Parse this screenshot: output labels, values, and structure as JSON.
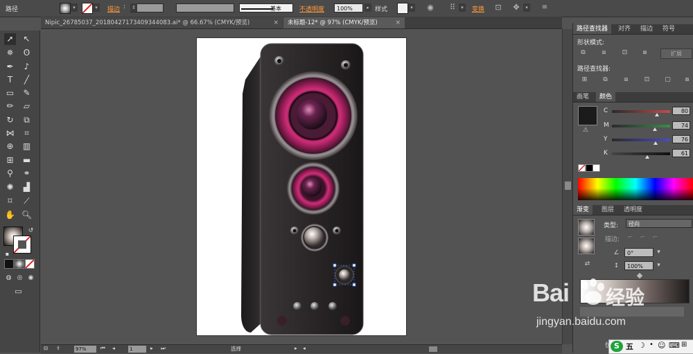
{
  "control_bar": {
    "path_label": "路径",
    "stroke_label": "描边",
    "stroke_style": "基本",
    "opacity_label": "不透明度",
    "opacity_value": "100%",
    "style_label": "样式",
    "transform_label": "变换"
  },
  "tabs": [
    {
      "label": "Nipic_26785037_20180427173409344083.ai* @ 66.67% (CMYK/预览)"
    },
    {
      "label": "未标题-12* @ 97% (CMYK/预览)"
    }
  ],
  "status": {
    "zoom": "97%",
    "page": "1",
    "mode": "选择"
  },
  "pathfinder": {
    "tabs": [
      "路径查找器",
      "对齐",
      "描边",
      "符号"
    ],
    "shape_modes_label": "形状模式:",
    "expand_label": "扩展",
    "pathfinders_label": "路径查找器:"
  },
  "color_panel": {
    "tabs": [
      "画笔",
      "颜色"
    ],
    "channels": [
      {
        "letter": "C",
        "value": "80",
        "color": "#c44b4b"
      },
      {
        "letter": "M",
        "value": "74",
        "color": "#3c8c4c"
      },
      {
        "letter": "Y",
        "value": "76",
        "color": "#4b4bc4"
      },
      {
        "letter": "K",
        "value": "61",
        "color": "#888888"
      }
    ],
    "fill_color": "#1b1b1b"
  },
  "gradient_panel": {
    "tabs": [
      "渐变",
      "图层",
      "透明度"
    ],
    "type_label": "类型:",
    "type_value": "径向",
    "stroke_label": "描边:",
    "angle_value": "0°",
    "aspect_value": "100%",
    "position_label": "位"
  },
  "watermark": {
    "brand": "Bai",
    "brand2": "经验",
    "url": "jingyan.baidu.com"
  },
  "ime": {
    "label": "五"
  },
  "accent_colors": {
    "speaker_magenta": "#c8236b",
    "speaker_body": "#1e1b1c",
    "ui_orange": "#ff9a3c"
  }
}
